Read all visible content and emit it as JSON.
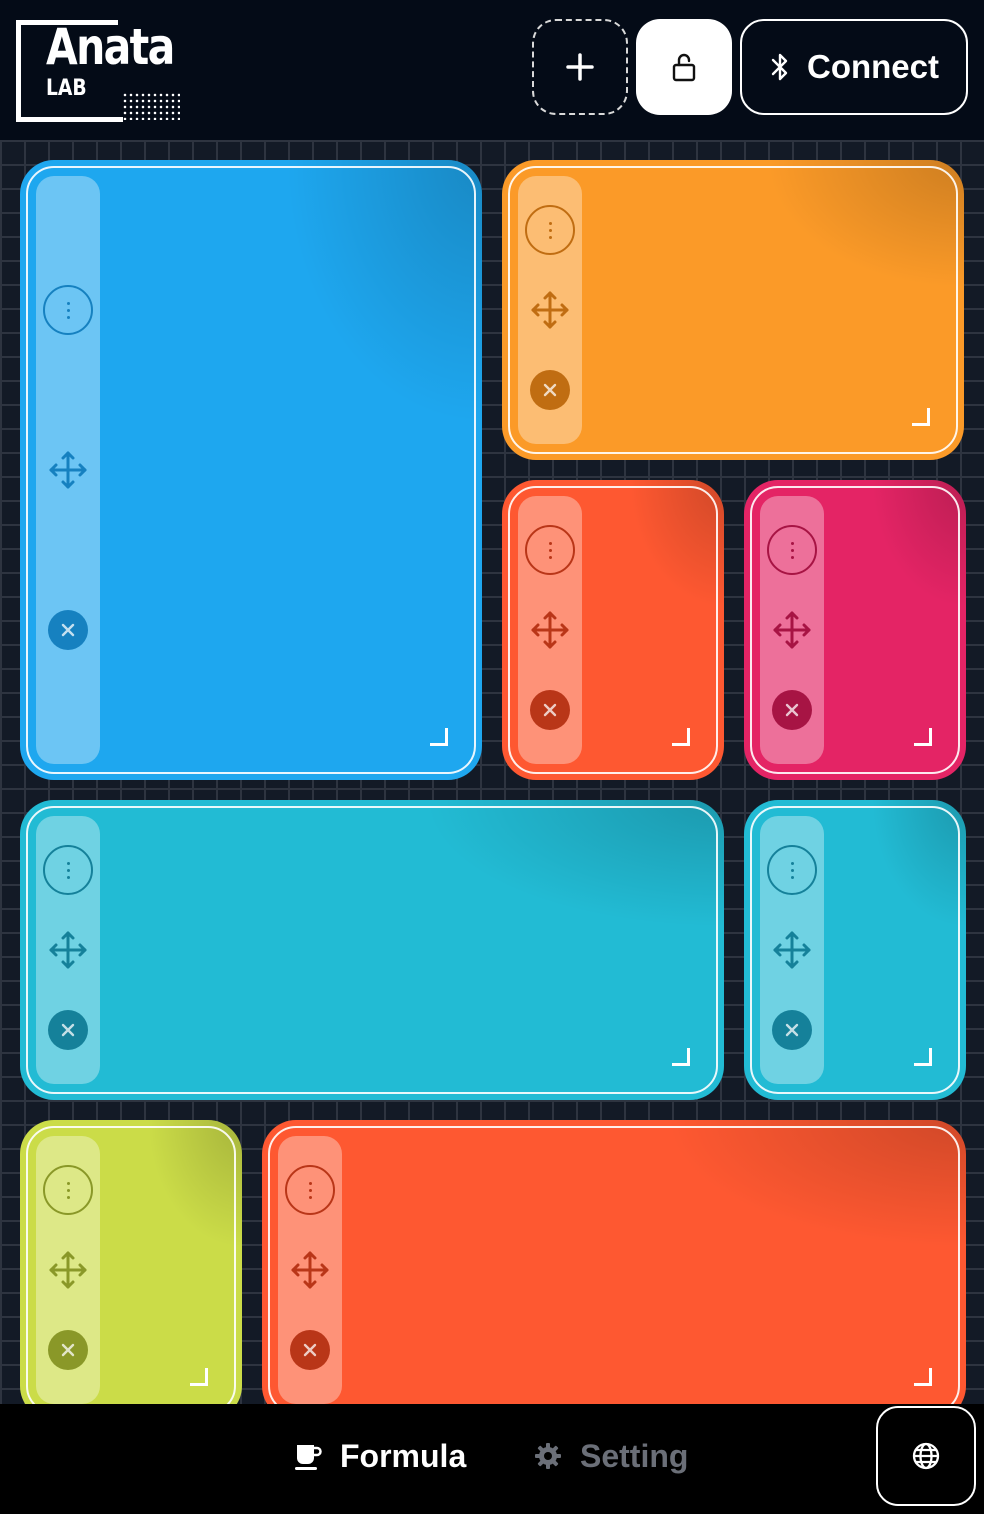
{
  "header": {
    "logo_name": "Anata",
    "logo_sub": "LAB",
    "add_icon": "plus-icon",
    "lock_icon": "unlock-icon",
    "connect_icon": "bluetooth-icon",
    "connect_label": "Connect"
  },
  "tiles": [
    {
      "id": "tile-blue",
      "color": "#1ea7ef",
      "shade": "#1681c0"
    },
    {
      "id": "tile-orange",
      "color": "#fb9a28",
      "shade": "#c06d12"
    },
    {
      "id": "tile-red-small",
      "color": "#fe5831",
      "shade": "#b93618"
    },
    {
      "id": "tile-pink",
      "color": "#e42465",
      "shade": "#a71444"
    },
    {
      "id": "tile-cyan-wide",
      "color": "#22bbd4",
      "shade": "#15819a"
    },
    {
      "id": "tile-cyan-small",
      "color": "#22bbd4",
      "shade": "#15819a"
    },
    {
      "id": "tile-lime",
      "color": "#cbdc48",
      "shade": "#8a9828"
    },
    {
      "id": "tile-red-wide",
      "color": "#fe5831",
      "shade": "#b93618"
    }
  ],
  "tile_handle_icons": [
    "more-vertical-icon",
    "move-icon",
    "close-icon"
  ],
  "bottom_nav": {
    "formula_label": "Formula",
    "formula_icon": "coffee-cup-icon",
    "setting_label": "Setting",
    "setting_icon": "gear-icon",
    "language_icon": "globe-icon"
  },
  "colors": {
    "header_bg": "#040b17",
    "board_bg": "#131a26",
    "grid_line": "#2e3440",
    "inactive_nav": "#6b6f78"
  }
}
